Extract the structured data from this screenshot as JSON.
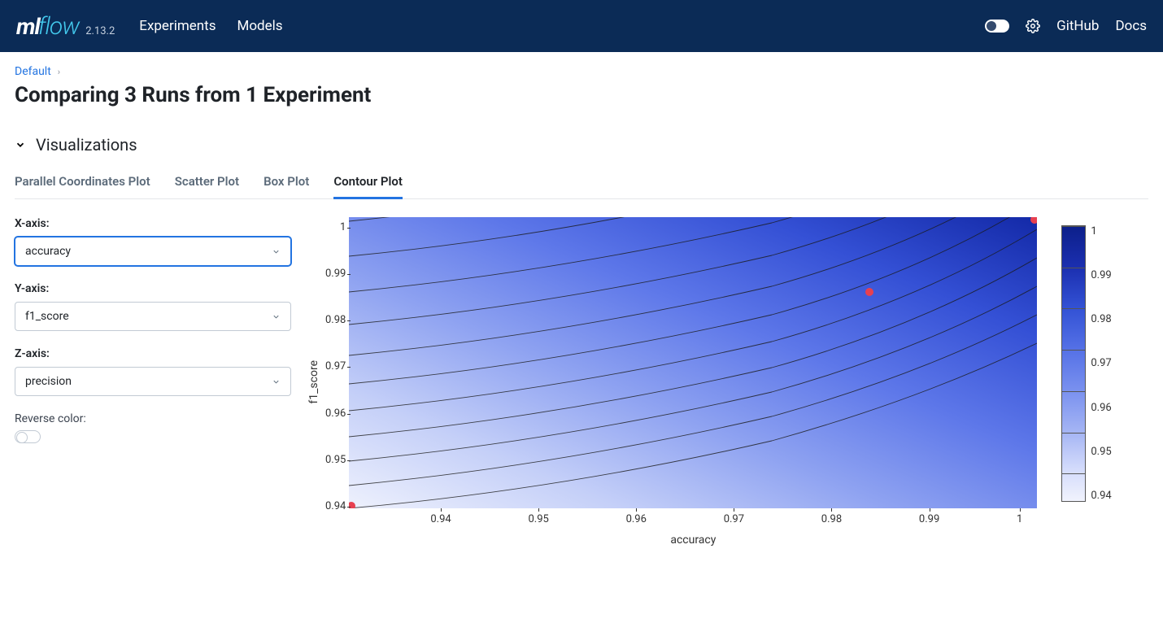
{
  "header": {
    "logo_ml": "ml",
    "logo_flow": "flow",
    "version": "2.13.2",
    "nav": {
      "experiments": "Experiments",
      "models": "Models"
    },
    "github": "GitHub",
    "docs": "Docs"
  },
  "breadcrumb": {
    "root": "Default"
  },
  "page_title": "Comparing 3 Runs from 1 Experiment",
  "section": {
    "visualizations": "Visualizations"
  },
  "tabs": {
    "parallel": "Parallel Coordinates Plot",
    "scatter": "Scatter Plot",
    "box": "Box Plot",
    "contour": "Contour Plot"
  },
  "controls": {
    "x_label": "X-axis:",
    "x_value": "accuracy",
    "y_label": "Y-axis:",
    "y_value": "f1_score",
    "z_label": "Z-axis:",
    "z_value": "precision",
    "reverse_label": "Reverse color:"
  },
  "chart_data": {
    "type": "contour",
    "xlabel": "accuracy",
    "ylabel": "f1_score",
    "zlabel": "precision",
    "xlim": [
      0.93,
      1.0
    ],
    "ylim": [
      0.934,
      1.0
    ],
    "zlim": [
      0.934,
      1.0
    ],
    "x_ticks": [
      "0.94",
      "0.95",
      "0.96",
      "0.97",
      "0.98",
      "0.99",
      "1"
    ],
    "y_ticks": [
      "1",
      "0.99",
      "0.98",
      "0.97",
      "0.96",
      "0.95",
      "0.94"
    ],
    "colorbar_ticks": [
      "1",
      "0.99",
      "0.98",
      "0.97",
      "0.96",
      "0.95",
      "0.94"
    ],
    "scatter_points": [
      {
        "x": 0.983,
        "y": 0.984
      },
      {
        "x": 1.0,
        "y": 1.0
      },
      {
        "x": 0.93,
        "y": 0.934
      }
    ]
  }
}
